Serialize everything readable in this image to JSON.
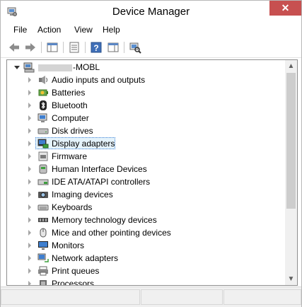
{
  "window": {
    "title": "Device Manager",
    "close_glyph": "✕"
  },
  "menu": [
    {
      "label": "File"
    },
    {
      "label": "Action"
    },
    {
      "label": "View"
    },
    {
      "label": "Help"
    }
  ],
  "toolbar": {
    "buttons": [
      "back-icon",
      "forward-icon",
      "show-hide-console-tree-icon",
      "properties-icon",
      "help-icon",
      "show-action-pane-icon",
      "scan-hardware-icon"
    ]
  },
  "tree": {
    "root": {
      "label": "-MOBL",
      "expanded": true
    },
    "selected_index": 5,
    "categories": [
      {
        "label": "Audio inputs and outputs",
        "icon": "speaker-icon"
      },
      {
        "label": "Batteries",
        "icon": "battery-icon"
      },
      {
        "label": "Bluetooth",
        "icon": "bluetooth-icon"
      },
      {
        "label": "Computer",
        "icon": "computer-icon"
      },
      {
        "label": "Disk drives",
        "icon": "disk-drive-icon"
      },
      {
        "label": "Display adapters",
        "icon": "display-adapter-icon"
      },
      {
        "label": "Firmware",
        "icon": "firmware-icon"
      },
      {
        "label": "Human Interface Devices",
        "icon": "hid-icon"
      },
      {
        "label": "IDE ATA/ATAPI controllers",
        "icon": "ide-controller-icon"
      },
      {
        "label": "Imaging devices",
        "icon": "camera-icon"
      },
      {
        "label": "Keyboards",
        "icon": "keyboard-icon"
      },
      {
        "label": "Memory technology devices",
        "icon": "memory-icon"
      },
      {
        "label": "Mice and other pointing devices",
        "icon": "mouse-icon"
      },
      {
        "label": "Monitors",
        "icon": "monitor-icon"
      },
      {
        "label": "Network adapters",
        "icon": "network-adapter-icon"
      },
      {
        "label": "Print queues",
        "icon": "printer-icon"
      },
      {
        "label": "Processors",
        "icon": "processor-icon"
      }
    ]
  },
  "colors": {
    "selection": "#e5f3fb",
    "selection_border": "#3a7fd5",
    "close": "#c75050"
  }
}
